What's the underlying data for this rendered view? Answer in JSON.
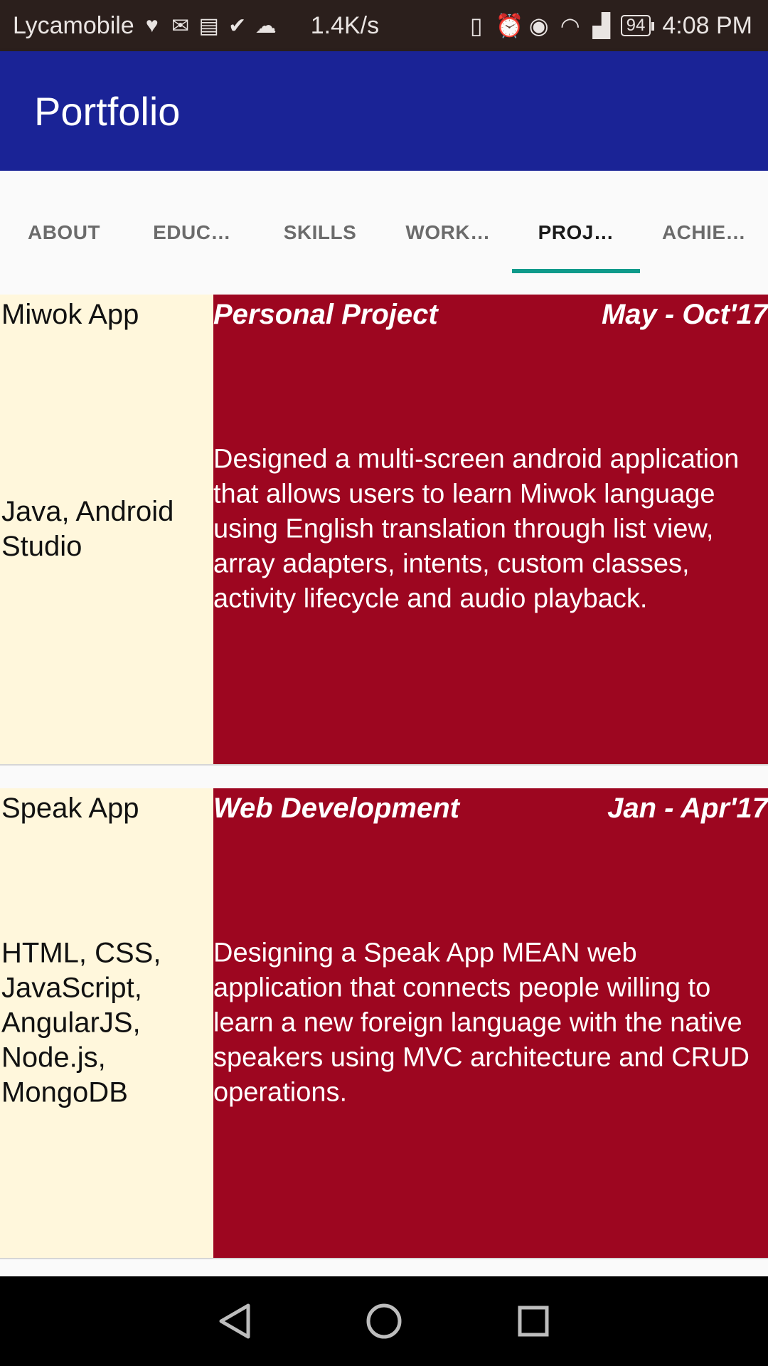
{
  "status_bar": {
    "carrier": "Lycamobile",
    "left_icons": [
      "health-icon",
      "gmail-icon",
      "news-icon",
      "check-icon",
      "cloud-icon"
    ],
    "speed": "1.4K/s",
    "right_icons": [
      "vibrate-icon",
      "alarm-icon",
      "eye-icon",
      "wifi-icon",
      "signal-icon"
    ],
    "battery": "94",
    "time": "4:08 PM"
  },
  "app_bar": {
    "title": "Portfolio"
  },
  "tabs": [
    {
      "label": "ABOUT",
      "active": false
    },
    {
      "label": "EDUC…",
      "active": false
    },
    {
      "label": "SKILLS",
      "active": false
    },
    {
      "label": "WORK…",
      "active": false
    },
    {
      "label": "PROJ…",
      "active": true
    },
    {
      "label": "ACHIE…",
      "active": false
    }
  ],
  "accent_color": "#0e9a8a",
  "projects": [
    {
      "name": "Miwok App",
      "tech": "Java, Android Studio",
      "type": "Personal Project",
      "date": "May - Oct'17",
      "description": "Designed a multi-screen android application that allows users to learn Miwok language using English translation through list view, array adapters, intents, custom classes, activity lifecycle and audio playback."
    },
    {
      "name": "Speak App",
      "tech": "HTML, CSS, JavaScript, AngularJS, Node.js, MongoDB",
      "type": "Web Development",
      "date": "Jan - Apr'17",
      "description": "Designing a Speak App MEAN web application that connects people willing to learn a new foreign language with the native speakers using MVC architecture and CRUD operations."
    }
  ],
  "nav_bar": {
    "icons": [
      "back-icon",
      "home-icon",
      "recents-icon"
    ]
  }
}
